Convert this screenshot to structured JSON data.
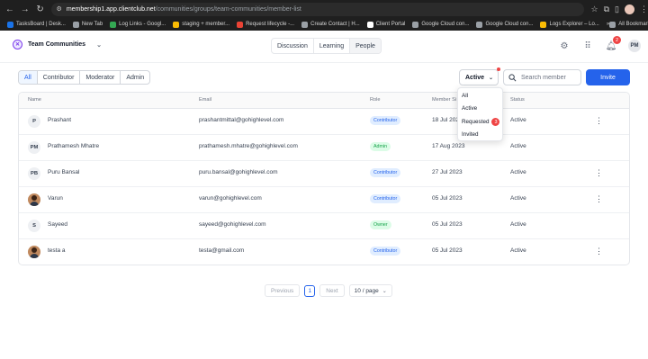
{
  "browser": {
    "url_host": "membership1.app.clientclub.net",
    "url_path": "/communities/groups/team-communities/member-list",
    "bookmarks": [
      {
        "label": "TasksBoard | Desk...",
        "color": "#1a73e8"
      },
      {
        "label": "New Tab",
        "color": "#9aa0a6"
      },
      {
        "label": "Log Links - Googl...",
        "color": "#34a853"
      },
      {
        "label": "staging + member...",
        "color": "#fbbc04"
      },
      {
        "label": "Request lifecycle -...",
        "color": "#ea4335"
      },
      {
        "label": "Create Contact | H...",
        "color": "#9aa0a6"
      },
      {
        "label": "Client Portal",
        "color": "#ffffff"
      },
      {
        "label": "Google Cloud con...",
        "color": "#9aa0a6"
      },
      {
        "label": "Google Cloud con...",
        "color": "#9aa0a6"
      },
      {
        "label": "Logs Explorer – Lo...",
        "color": "#fbbc04"
      }
    ],
    "overflow_label": "»",
    "all_bookmarks_label": "All Bookmarks"
  },
  "header": {
    "community_name": "Team Communities",
    "community_initial": "✕",
    "tabs": [
      {
        "label": "Discussion",
        "active": false
      },
      {
        "label": "Learning",
        "active": false
      },
      {
        "label": "People",
        "active": true
      }
    ],
    "notification_count": "2",
    "user_initials": "PM"
  },
  "filters": {
    "roles": [
      {
        "label": "All",
        "active": true
      },
      {
        "label": "Contributor",
        "active": false
      },
      {
        "label": "Moderator",
        "active": false
      },
      {
        "label": "Admin",
        "active": false
      }
    ],
    "status_value": "Active",
    "search_placeholder": "Search member",
    "invite_label": "Invite"
  },
  "table": {
    "headers": {
      "name": "Name",
      "email": "Email",
      "role": "Role",
      "member_since": "Member Si",
      "status": "Status"
    },
    "rows": [
      {
        "initials": "P",
        "photo": false,
        "name": "Prashant",
        "email": "prashantmittal@gohighlevel.com",
        "role": "Contributor",
        "role_type": "contributor",
        "since": "18 Jul 2023",
        "status": "Active",
        "menu": true
      },
      {
        "initials": "PM",
        "photo": false,
        "name": "Prathamesh Mhatre",
        "email": "prathamesh.mhatre@gohighlevel.com",
        "role": "Admin",
        "role_type": "admin",
        "since": "17 Aug 2023",
        "status": "Active",
        "menu": false
      },
      {
        "initials": "PB",
        "photo": false,
        "name": "Puru Bansal",
        "email": "puru.bansal@gohighlevel.com",
        "role": "Contributor",
        "role_type": "contributor",
        "since": "27 Jul 2023",
        "status": "Active",
        "menu": true
      },
      {
        "initials": "",
        "photo": true,
        "name": "Varun",
        "email": "varun@gohighlevel.com",
        "role": "Contributor",
        "role_type": "contributor",
        "since": "05 Jul 2023",
        "status": "Active",
        "menu": true
      },
      {
        "initials": "S",
        "photo": false,
        "name": "Sayeed",
        "email": "sayeed@gohighlevel.com",
        "role": "Owner",
        "role_type": "owner",
        "since": "05 Jul 2023",
        "status": "Active",
        "menu": false
      },
      {
        "initials": "",
        "photo": true,
        "name": "testa a",
        "email": "testa@gmail.com",
        "role": "Contributor",
        "role_type": "contributor",
        "since": "05 Jul 2023",
        "status": "Active",
        "menu": true
      }
    ]
  },
  "status_dropdown": {
    "options": [
      {
        "label": "All",
        "badge": ""
      },
      {
        "label": "Active",
        "badge": ""
      },
      {
        "label": "Requested",
        "badge": "3"
      },
      {
        "label": "Invited",
        "badge": ""
      }
    ]
  },
  "pagination": {
    "previous_label": "Previous",
    "current_page": "1",
    "next_label": "Next",
    "page_size": "10 / page"
  }
}
